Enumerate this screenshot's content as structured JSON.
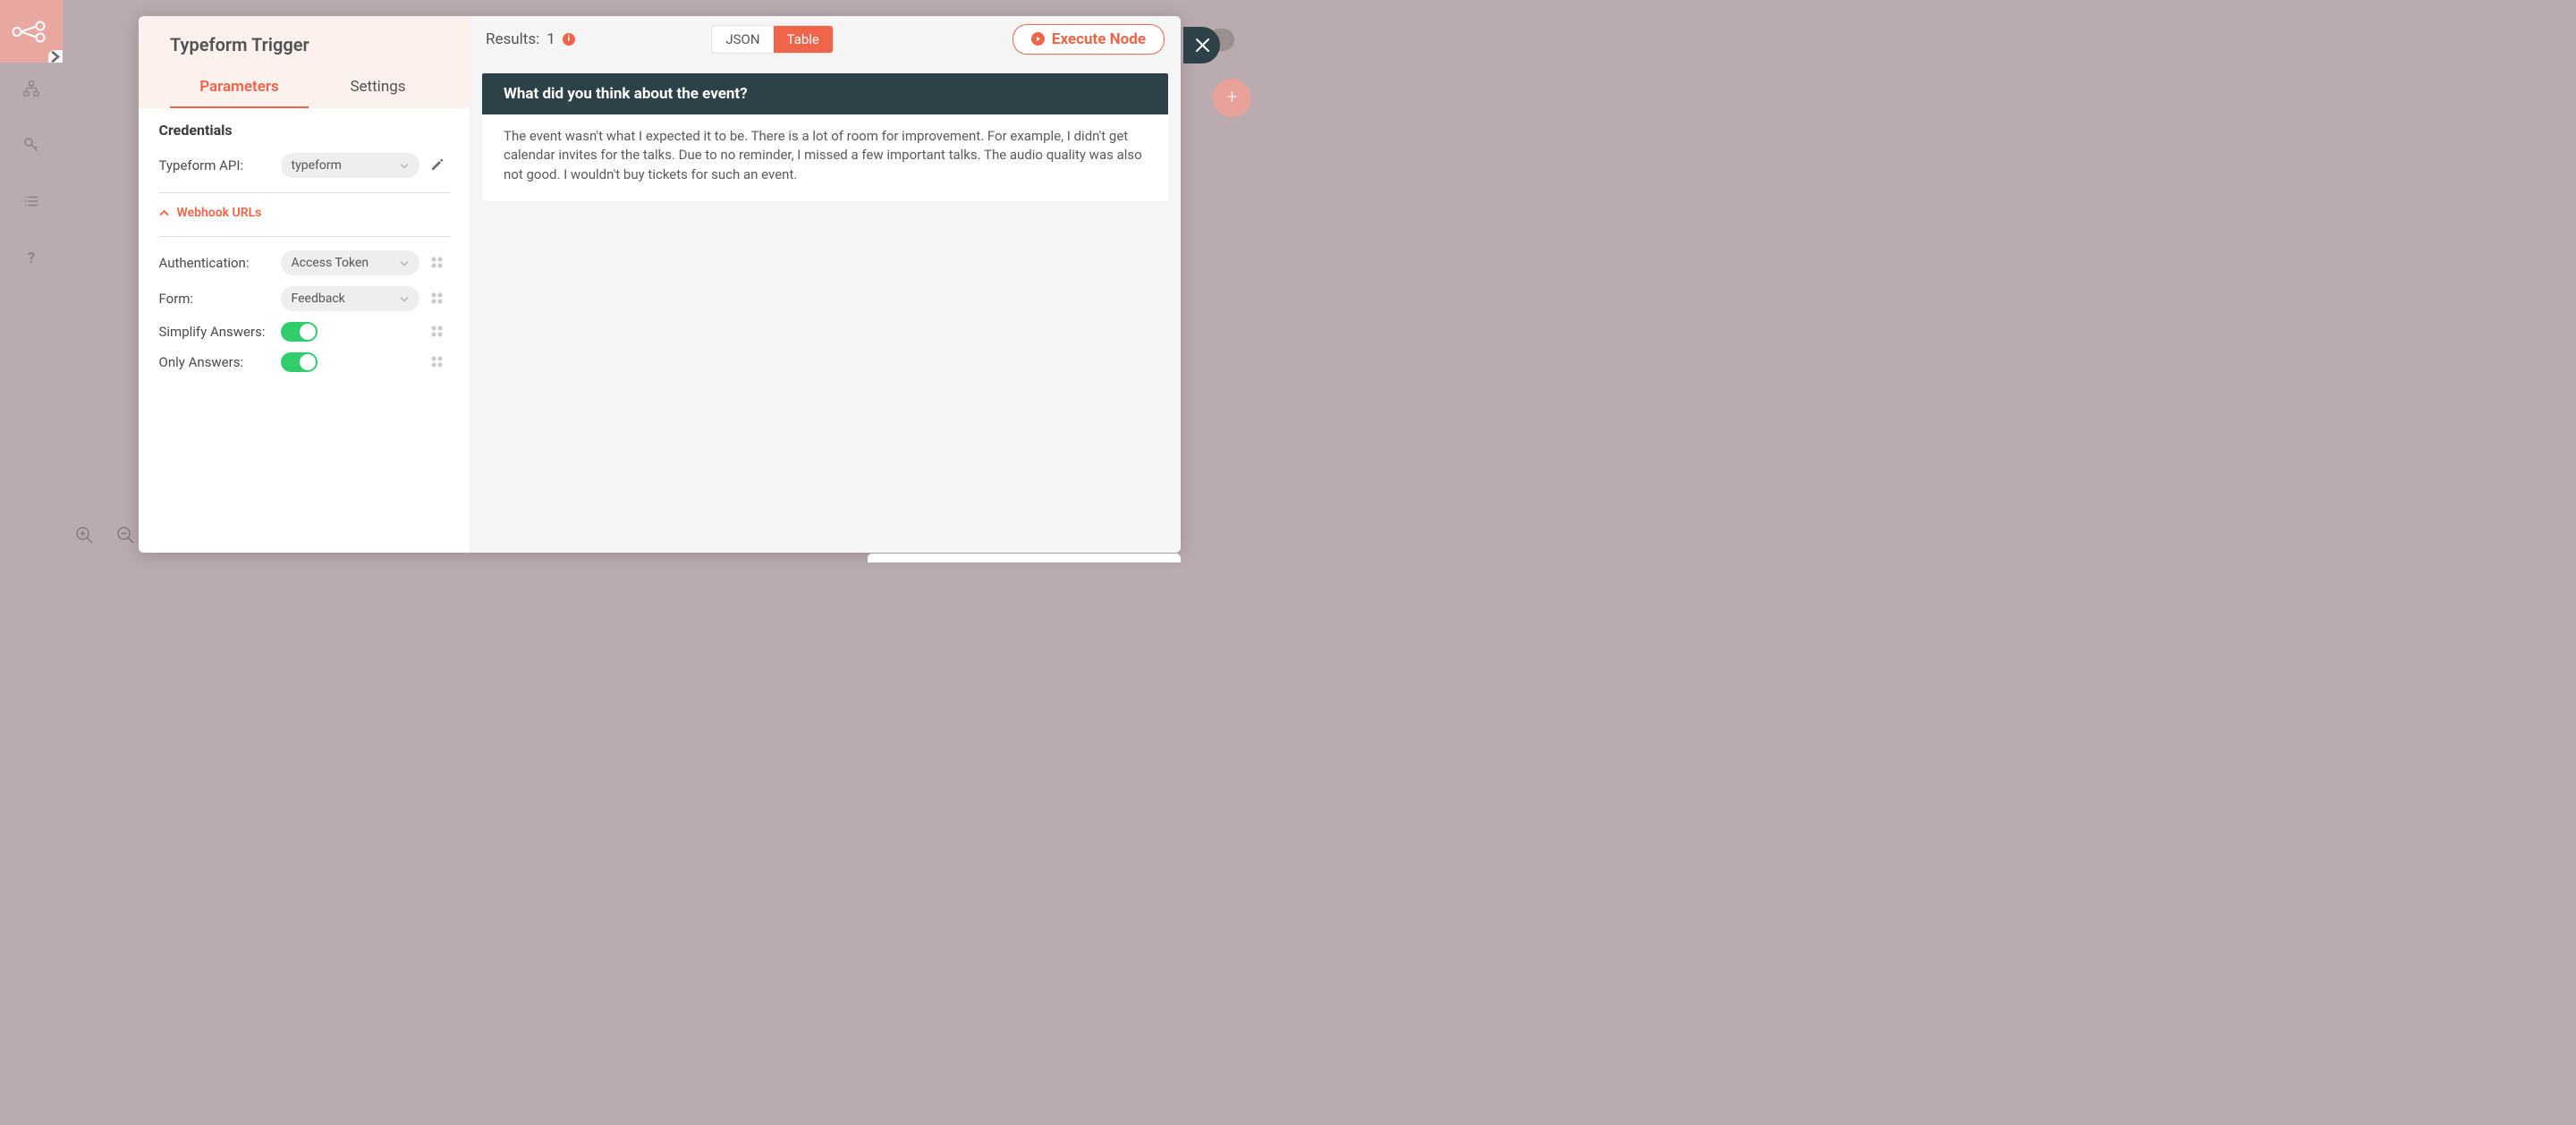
{
  "node_title": "Typeform Trigger",
  "tabs": {
    "parameters": "Parameters",
    "settings": "Settings"
  },
  "credentials_heading": "Credentials",
  "cred": {
    "label": "Typeform API:",
    "value": "typeform"
  },
  "webhook_label": "Webhook URLs",
  "params": {
    "auth": {
      "label": "Authentication:",
      "value": "Access Token"
    },
    "form": {
      "label": "Form:",
      "value": "Feedback"
    },
    "simplify": {
      "label": "Simplify Answers:"
    },
    "only": {
      "label": "Only Answers:"
    }
  },
  "right": {
    "results_label": "Results:",
    "result_count": "1",
    "view_json": "JSON",
    "view_table": "Table",
    "exec_label": "Execute Node"
  },
  "output": {
    "question": "What did you think about the event?",
    "answer": "The event wasn't what I expected it to be. There is a lot of room for improvement. For example, I didn't get calendar invites for the talks. Due to no reminder, I missed a few important talks. The audio quality was also not good. I wouldn't buy tickets for such an event."
  }
}
